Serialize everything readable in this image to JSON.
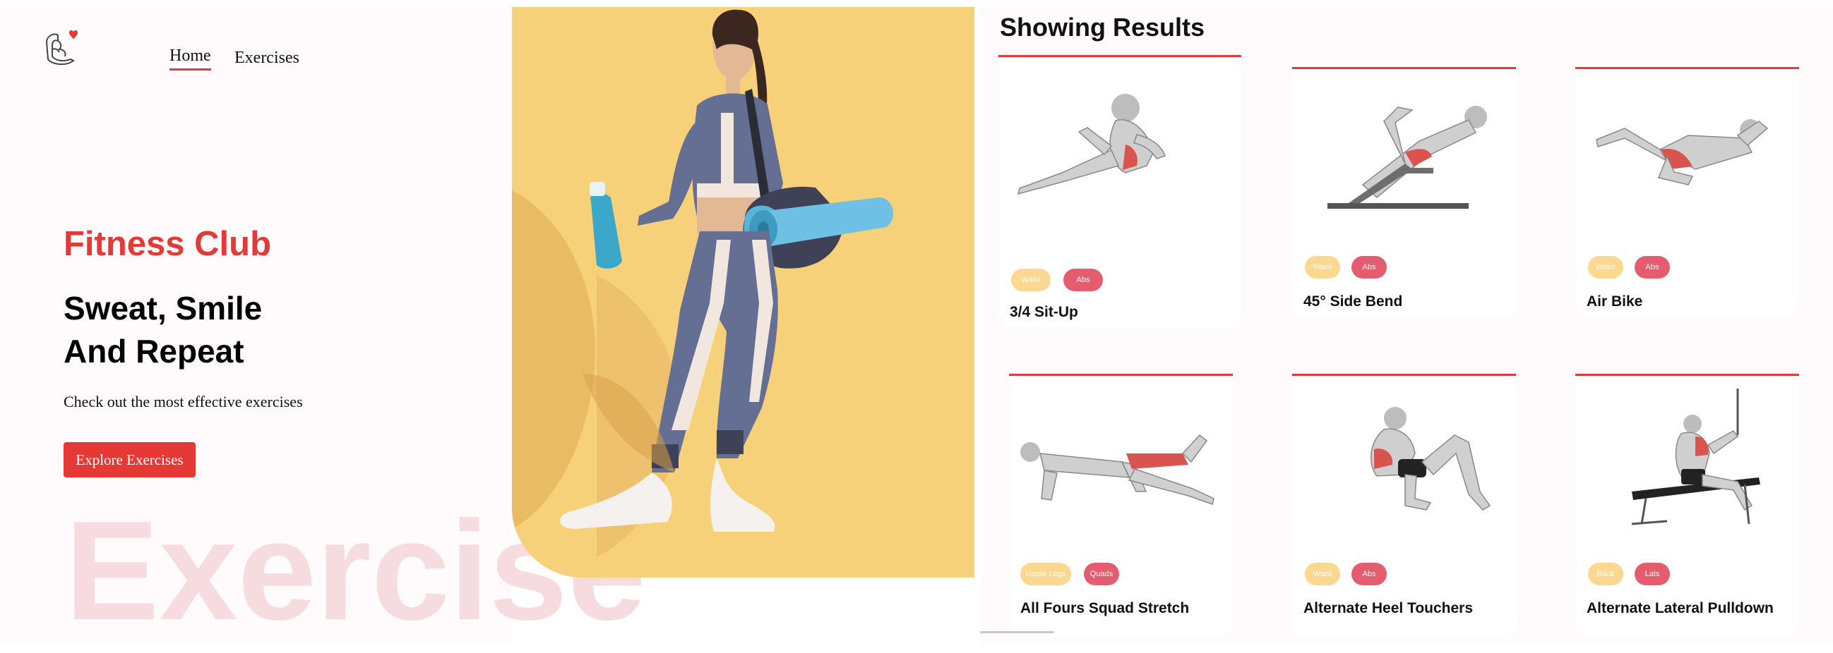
{
  "nav": {
    "logo_icon": "flexed-arm-heart-logo",
    "home_label": "Home",
    "exercises_label": "Exercises"
  },
  "hero": {
    "kicker": "Fitness Club",
    "headline_line1": "Sweat, Smile",
    "headline_line2": "And Repeat",
    "subtitle": "Check out the most effective exercises",
    "cta_label": "Explore Exercises",
    "watermark": "Exercise"
  },
  "results": {
    "title": "Showing Results",
    "cards": [
      {
        "name": "3/4 Sit-Up",
        "tags": [
          "Waist",
          "Abs"
        ]
      },
      {
        "name": "45° Side Bend",
        "tags": [
          "Waist",
          "Abs"
        ]
      },
      {
        "name": "Air Bike",
        "tags": [
          "Waist",
          "Abs"
        ]
      },
      {
        "name": "All Fours Squad Stretch",
        "tags": [
          "Upper Legs",
          "Quads"
        ]
      },
      {
        "name": "Alternate Heel Touchers",
        "tags": [
          "Waist",
          "Abs"
        ]
      },
      {
        "name": "Alternate Lateral Pulldown",
        "tags": [
          "Back",
          "Lats"
        ]
      }
    ]
  },
  "colors": {
    "accent": "#e53935",
    "tag_body_part": "#fbd78f",
    "tag_target": "#e45d6f",
    "hero_background": "#f7d07a",
    "watermark": "#f7dcdf",
    "page_background": "#fffafb"
  }
}
